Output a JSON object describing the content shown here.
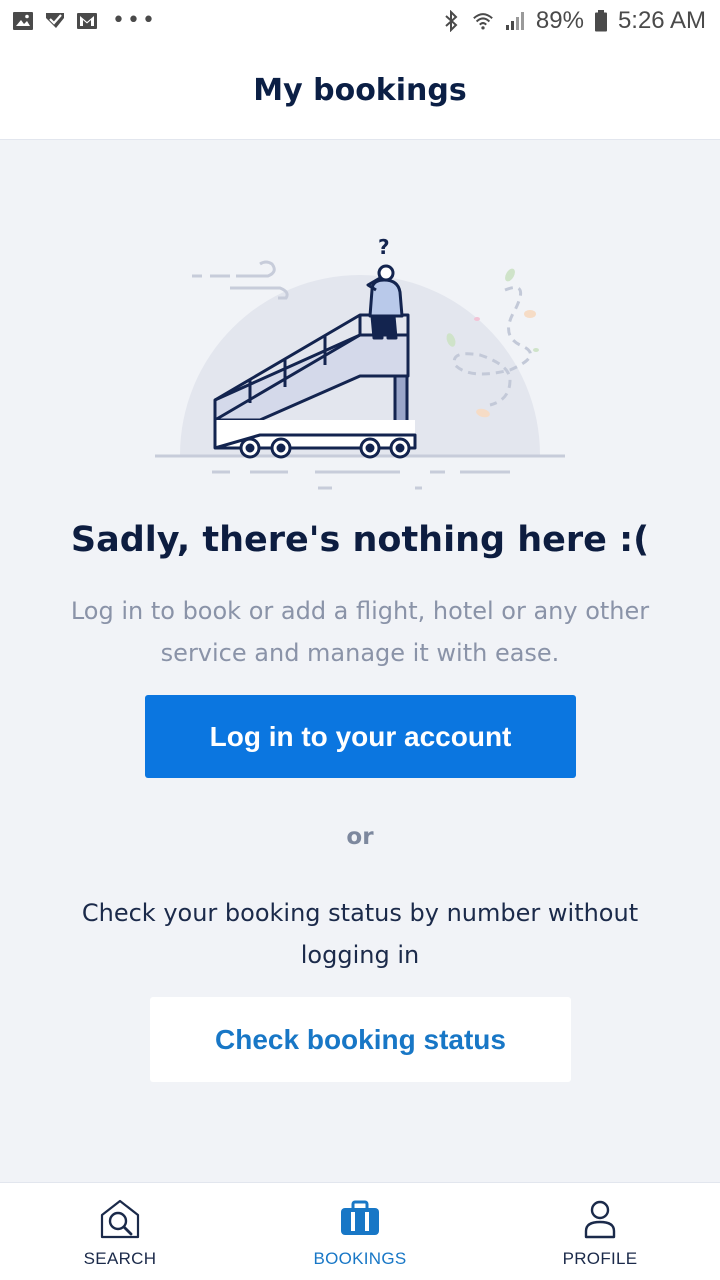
{
  "status_bar": {
    "battery": "89%",
    "time": "5:26 AM",
    "dots": "•••",
    "icons": [
      "image-icon",
      "check-icon",
      "gmail-icon",
      "bluetooth-icon",
      "wifi-icon",
      "signal-icon",
      "battery-icon"
    ]
  },
  "header": {
    "title": "My bookings"
  },
  "empty_state": {
    "title": "Sadly, there's nothing here :(",
    "description": "Log in to book or add a flight, hotel or any other service and manage it with ease.",
    "login_button": "Log in to your account",
    "or_label": "or",
    "check_description": "Check your booking status by number without logging in",
    "check_button": "Check booking status"
  },
  "bottom_nav": {
    "items": [
      {
        "label": "SEARCH",
        "icon": "search-icon",
        "active": false
      },
      {
        "label": "BOOKINGS",
        "icon": "briefcase-icon",
        "active": true
      },
      {
        "label": "PROFILE",
        "icon": "user-icon",
        "active": false
      }
    ]
  },
  "colors": {
    "primary": "#0b76e0",
    "link": "#1877c6",
    "background": "#f1f3f7",
    "navy": "#0d1d40"
  }
}
